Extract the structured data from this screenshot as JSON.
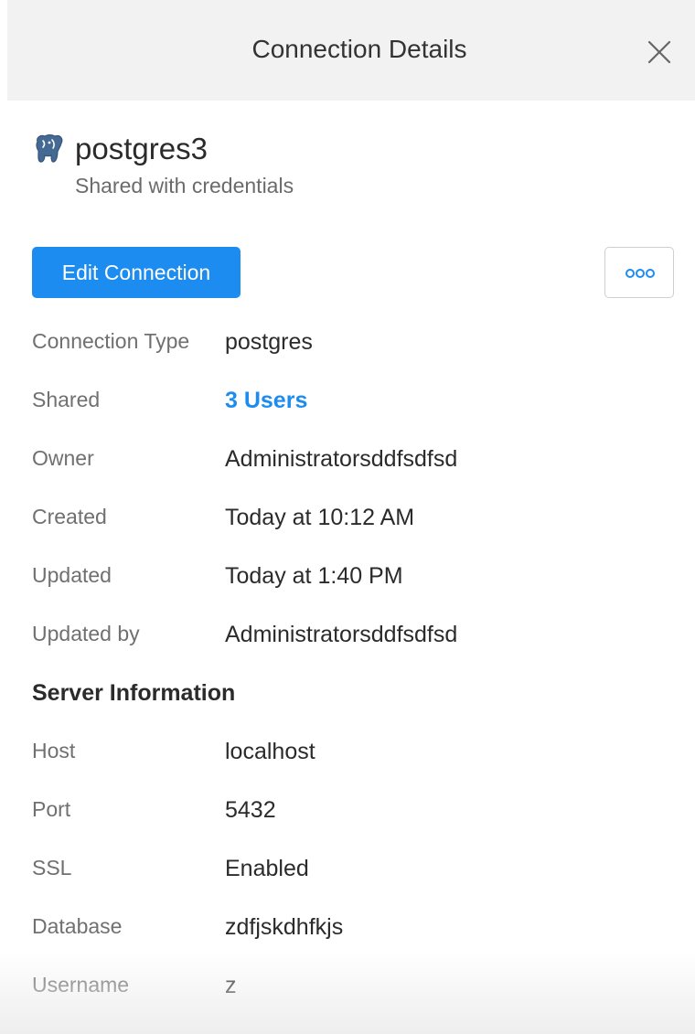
{
  "header": {
    "title": "Connection Details",
    "close_icon": "close-icon"
  },
  "connection": {
    "icon": "postgres-elephant-icon",
    "name": "postgres3",
    "subtitle": "Shared with credentials"
  },
  "actions": {
    "edit_label": "Edit Connection",
    "more_icon": "more-options-icon",
    "accent_color": "#1d8cf0"
  },
  "details": [
    {
      "label": "Connection Type",
      "value": "postgres"
    },
    {
      "label": "Shared",
      "value": "3 Users"
    },
    {
      "label": "Owner",
      "value": "Administratorsddfsdfsd"
    },
    {
      "label": "Created",
      "value": "Today at 10:12 AM"
    },
    {
      "label": "Updated",
      "value": "Today at 1:40 PM"
    },
    {
      "label": "Updated by",
      "value": "Administratorsddfsdfsd"
    }
  ],
  "server": {
    "title": "Server Information",
    "rows": [
      {
        "label": "Host",
        "value": "localhost"
      },
      {
        "label": "Port",
        "value": "5432"
      },
      {
        "label": "SSL",
        "value": "Enabled"
      },
      {
        "label": "Database",
        "value": "zdfjskdhfkjs"
      },
      {
        "label": "Username",
        "value": "z"
      }
    ]
  }
}
